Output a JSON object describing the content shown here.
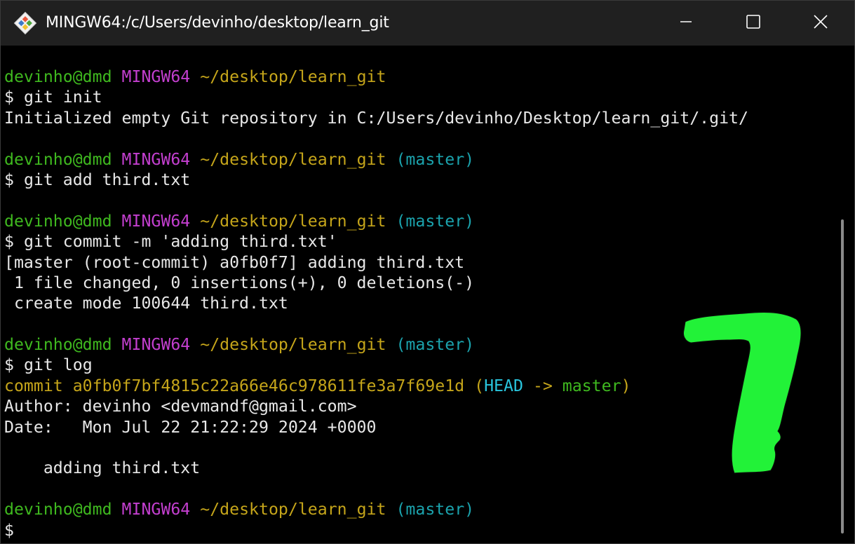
{
  "window": {
    "title": "MINGW64:/c/Users/devinho/desktop/learn_git",
    "app_icon": "git-diamond-icon",
    "controls": {
      "minimize": "minimize-icon",
      "maximize": "maximize-icon",
      "close": "close-icon"
    }
  },
  "prompt": {
    "user": "devinho@dmd",
    "host": "MINGW64",
    "path": "~/desktop/learn_git",
    "branch": "(master)",
    "symbol": "$"
  },
  "session": {
    "cmd1": "git init",
    "out1": "Initialized empty Git repository in C:/Users/devinho/Desktop/learn_git/.git/",
    "cmd2": "git add third.txt",
    "cmd3": "git commit -m 'adding third.txt'",
    "out3_1": "[master (root-commit) a0fb0f7] adding third.txt",
    "out3_2": " 1 file changed, 0 insertions(+), 0 deletions(-)",
    "out3_3": " create mode 100644 third.txt",
    "cmd4": "git log",
    "log": {
      "commit_label": "commit a0fb0f7bf4815c22a66e46c978611fe3a7f69e1d",
      "open_paren": "(",
      "head": "HEAD",
      "arrow": "->",
      "master": "master",
      "close_paren": ")",
      "author": "Author: devinho <devmandf@gmail.com>",
      "date": "Date:   Mon Jul 22 21:22:29 2024 +0000",
      "message": "    adding third.txt"
    }
  },
  "colors": {
    "user": "#3fb91f",
    "host": "#c33fcf",
    "path": "#c5a51a",
    "branch": "#1ba3ad",
    "head": "#29c4dc",
    "annotation": "#22f238",
    "titlebar": "#202020",
    "background": "#000000"
  },
  "annotation": {
    "icon": "question-mark-icon"
  }
}
